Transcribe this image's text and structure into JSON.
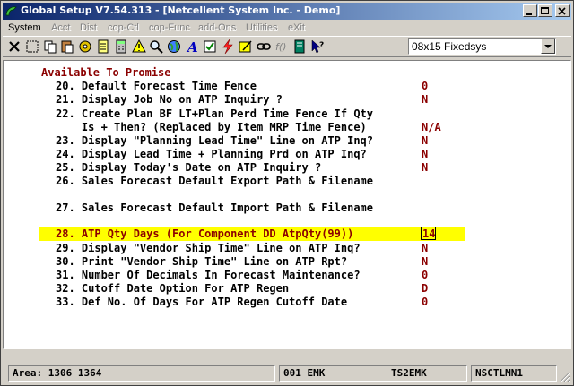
{
  "window": {
    "title": "Global Setup V7.54.313 - [Netcellent System Inc. - Demo]"
  },
  "menu": [
    {
      "label": "System",
      "enabled": true
    },
    {
      "label": "Acct",
      "enabled": false
    },
    {
      "label": "Dist",
      "enabled": false
    },
    {
      "label": "cop-Ctl",
      "enabled": false
    },
    {
      "label": "cop-Func",
      "enabled": false
    },
    {
      "label": "add-Ons",
      "enabled": false
    },
    {
      "label": "Utilities",
      "enabled": false
    },
    {
      "label": "eXit",
      "enabled": false
    }
  ],
  "toolbar": {
    "icons": [
      "close-x-icon",
      "select-icon",
      "copy-icon",
      "paste-icon",
      "gear-icon",
      "notepad-icon",
      "calculator-icon",
      "alert-icon",
      "search-icon",
      "globe-icon",
      "font-icon",
      "check-icon",
      "lightning-icon",
      "edit-sign-icon",
      "link-icon",
      "script-icon",
      "book-icon",
      "help-cursor-icon"
    ],
    "font_select": "08x15 Fixedsys"
  },
  "terminal": {
    "heading": "Available To Promise",
    "lines": [
      {
        "text": "20. Default Forecast Time Fence",
        "value": "0"
      },
      {
        "text": "21. Display Job No on ATP Inquiry ?",
        "value": "N"
      },
      {
        "text": "22. Create Plan BF LT+Plan Perd Time Fence If Qty",
        "value": ""
      },
      {
        "text": "    Is + Then? (Replaced by Item MRP Time Fence)",
        "value": "N/A"
      },
      {
        "text": "23. Display \"Planning Lead Time\" Line on ATP Inq?",
        "value": "N"
      },
      {
        "text": "24. Display Lead Time + Planning Prd on ATP Inq?",
        "value": "N"
      },
      {
        "text": "25. Display Today's Date on ATP Inquiry ?",
        "value": "N"
      },
      {
        "text": "26. Sales Forecast Default Export Path & Filename",
        "value": ""
      },
      {
        "text": "",
        "value": ""
      },
      {
        "text": "27. Sales Forecast Default Import Path & Filename",
        "value": ""
      },
      {
        "text": "",
        "value": ""
      },
      {
        "text": "28. ATP Qty Days (For Component DD AtpQty(99))",
        "value": "14"
      },
      {
        "text": "29. Display \"Vendor Ship Time\" Line on ATP Inq?",
        "value": "N"
      },
      {
        "text": "30. Print \"Vendor Ship Time\" Line on ATP Rpt?",
        "value": "N"
      },
      {
        "text": "31. Number Of Decimals In Forecast Maintenance?",
        "value": "0"
      },
      {
        "text": "32. Cutoff Date Option For ATP Regen",
        "value": "D"
      },
      {
        "text": "33. Def No. Of Days For ATP Regen Cutoff Date",
        "value": "0"
      }
    ]
  },
  "status": {
    "area": "Area: 1306 1364",
    "user": "001 EMK",
    "terminal": "TS2EMK",
    "menu": "NSCTLMN1"
  }
}
